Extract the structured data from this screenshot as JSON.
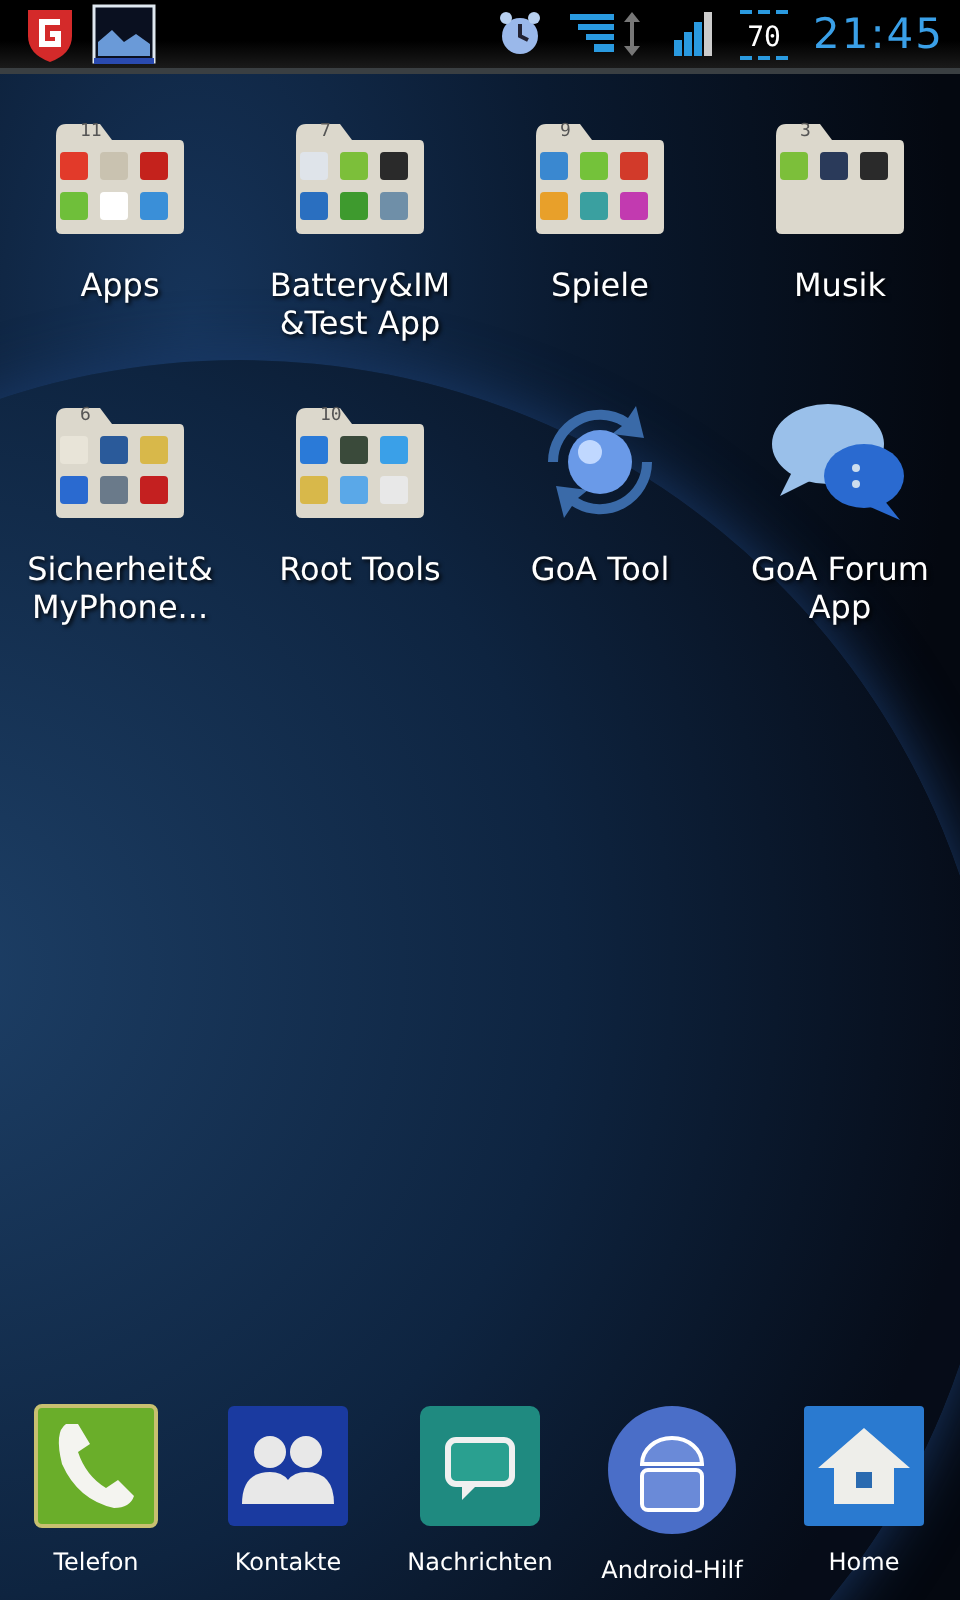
{
  "status_bar": {
    "battery": "70",
    "time": "21:45"
  },
  "home_items": [
    {
      "kind": "folder",
      "count": "11",
      "label": "Apps"
    },
    {
      "kind": "folder",
      "count": "7",
      "label": "Battery&IM &Test App"
    },
    {
      "kind": "folder",
      "count": "9",
      "label": "Spiele"
    },
    {
      "kind": "folder",
      "count": "3",
      "label": "Musik"
    },
    {
      "kind": "folder",
      "count": "6",
      "label": "Sicherheit& MyPhone..."
    },
    {
      "kind": "folder",
      "count": "10",
      "label": "Root Tools"
    },
    {
      "kind": "app",
      "label": "GoA Tool"
    },
    {
      "kind": "app",
      "label": "GoA Forum App"
    }
  ],
  "dock": [
    {
      "label": "Telefon"
    },
    {
      "label": "Kontakte"
    },
    {
      "label": "Nachrichten"
    },
    {
      "label": "Android-Hilf"
    },
    {
      "label": "Home"
    }
  ]
}
